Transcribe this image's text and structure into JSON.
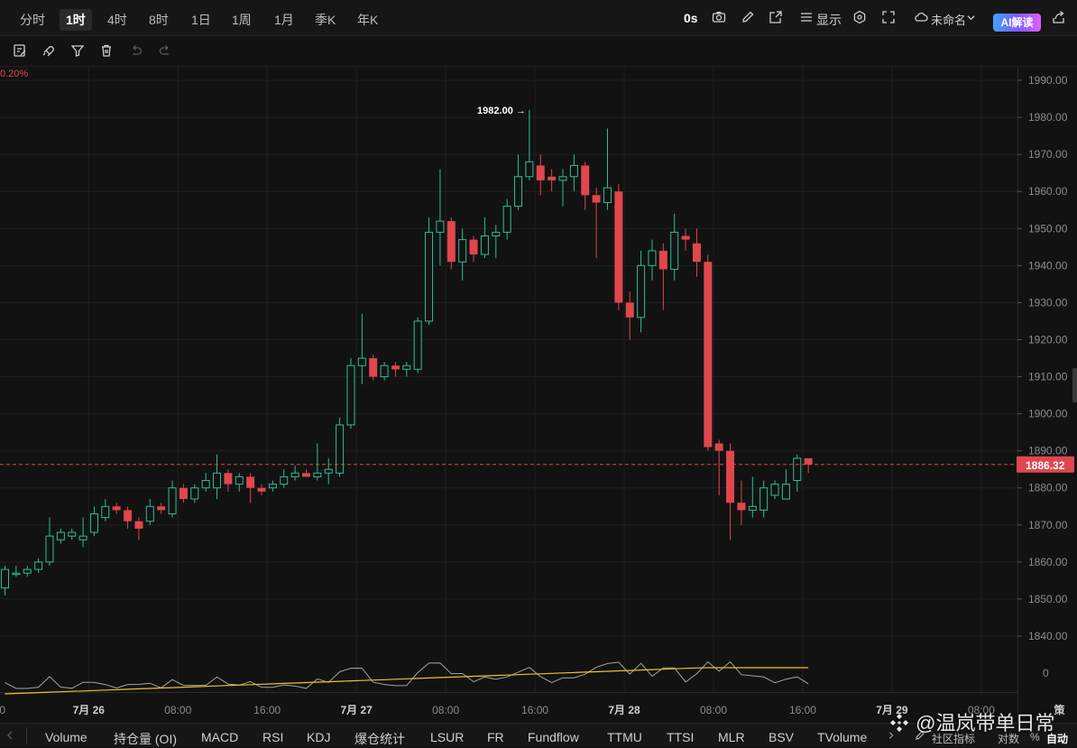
{
  "timeframes": [
    "分时",
    "1时",
    "4时",
    "8时",
    "1日",
    "1周",
    "1月",
    "季K",
    "年K"
  ],
  "active_timeframe": "1时",
  "right_tools": {
    "countdown": "0s",
    "display_label": "显示",
    "layout_name": "未命名",
    "ai_label": "AI解读"
  },
  "percent_label": "0.20%",
  "chart_data": {
    "type": "candlestick",
    "ylim": [
      1835,
      1995
    ],
    "y_ticks": [
      1990,
      1980,
      1970,
      1960,
      1950,
      1940,
      1930,
      1920,
      1910,
      1900,
      1890,
      1880,
      1870,
      1860,
      1850,
      1840
    ],
    "y_tick_labels": [
      "1990.00",
      "1980.00",
      "1970.00",
      "1960.00",
      "1950.00",
      "1940.00",
      "1930.00",
      "1920.00",
      "1910.00",
      "1900.00",
      "1890.00",
      "1880.00",
      "1870.00",
      "1860.00",
      "1850.00",
      "1840.00"
    ],
    "x_labels": [
      {
        "label": "00",
        "bar": -0.5
      },
      {
        "label": "7月 26",
        "bar": 7.5
      },
      {
        "label": "08:00",
        "bar": 15.5
      },
      {
        "label": "16:00",
        "bar": 23.5
      },
      {
        "label": "7月 27",
        "bar": 31.5
      },
      {
        "label": "08:00",
        "bar": 39.5
      },
      {
        "label": "16:00",
        "bar": 47.5
      },
      {
        "label": "7月 28",
        "bar": 55.5
      },
      {
        "label": "08:00",
        "bar": 63.5
      },
      {
        "label": "16:00",
        "bar": 71.5
      },
      {
        "label": "7月 29",
        "bar": 79.5
      },
      {
        "label": "08:00",
        "bar": 87.5
      },
      {
        "label": "策",
        "bar": 94.5
      }
    ],
    "current_price": 1886.32,
    "current_price_label": "1886.32",
    "high_label": "1982.00 →",
    "high_value": 1982.0,
    "candles": [
      [
        1853,
        1858,
        1851,
        1859
      ],
      [
        1857,
        1857,
        1856,
        1859
      ],
      [
        1857,
        1858,
        1856,
        1859
      ],
      [
        1858,
        1860,
        1857,
        1861
      ],
      [
        1860,
        1867,
        1859,
        1872
      ],
      [
        1866,
        1868,
        1865,
        1869
      ],
      [
        1867,
        1868,
        1866,
        1869
      ],
      [
        1866,
        1867,
        1864,
        1872
      ],
      [
        1868,
        1873,
        1867,
        1875
      ],
      [
        1872,
        1875,
        1871,
        1877
      ],
      [
        1875,
        1874,
        1873,
        1876
      ],
      [
        1874,
        1871,
        1869,
        1875
      ],
      [
        1871,
        1869,
        1866,
        1872
      ],
      [
        1871,
        1875,
        1870,
        1877
      ],
      [
        1875,
        1874,
        1873,
        1876
      ],
      [
        1873,
        1880,
        1872,
        1882
      ],
      [
        1880,
        1877,
        1876,
        1881
      ],
      [
        1877,
        1880,
        1876,
        1881
      ],
      [
        1880,
        1882,
        1879,
        1884
      ],
      [
        1880,
        1884,
        1877,
        1889
      ],
      [
        1884,
        1881,
        1879,
        1885
      ],
      [
        1881,
        1883,
        1879,
        1884
      ],
      [
        1883,
        1880,
        1876,
        1884
      ],
      [
        1880,
        1879,
        1878,
        1881
      ],
      [
        1880,
        1881,
        1879,
        1882
      ],
      [
        1881,
        1883,
        1880,
        1885
      ],
      [
        1883,
        1884,
        1882,
        1886
      ],
      [
        1884,
        1883,
        1883,
        1885
      ],
      [
        1883,
        1884,
        1882,
        1892
      ],
      [
        1884,
        1885,
        1881,
        1888
      ],
      [
        1884,
        1897,
        1883,
        1899
      ],
      [
        1897,
        1913,
        1896,
        1915
      ],
      [
        1913,
        1915,
        1908,
        1927
      ],
      [
        1915,
        1910,
        1909,
        1916
      ],
      [
        1910,
        1913,
        1909,
        1914
      ],
      [
        1913,
        1912,
        1910,
        1914
      ],
      [
        1912,
        1913,
        1910,
        1914
      ],
      [
        1912,
        1925,
        1911,
        1926
      ],
      [
        1925,
        1949,
        1924,
        1953
      ],
      [
        1949,
        1952,
        1940,
        1966
      ],
      [
        1952,
        1941,
        1939,
        1953
      ],
      [
        1941,
        1947,
        1936,
        1950
      ],
      [
        1947,
        1943,
        1941,
        1948
      ],
      [
        1943,
        1948,
        1942,
        1953
      ],
      [
        1948,
        1949,
        1942,
        1951
      ],
      [
        1949,
        1956,
        1947,
        1958
      ],
      [
        1956,
        1964,
        1955,
        1970
      ],
      [
        1964,
        1968,
        1963,
        1982
      ],
      [
        1967,
        1963,
        1959,
        1970
      ],
      [
        1964,
        1963,
        1960,
        1966
      ],
      [
        1963,
        1964,
        1956,
        1966
      ],
      [
        1964,
        1967,
        1960,
        1970
      ],
      [
        1967,
        1959,
        1955,
        1968
      ],
      [
        1959,
        1957,
        1942,
        1961
      ],
      [
        1957,
        1961,
        1955,
        1977
      ],
      [
        1960,
        1930,
        1928,
        1962
      ],
      [
        1930,
        1926,
        1920,
        1933
      ],
      [
        1926,
        1940,
        1922,
        1944
      ],
      [
        1940,
        1944,
        1936,
        1947
      ],
      [
        1944,
        1939,
        1928,
        1946
      ],
      [
        1939,
        1949,
        1936,
        1954
      ],
      [
        1948,
        1947,
        1944,
        1950
      ],
      [
        1946,
        1941,
        1937,
        1950
      ],
      [
        1941,
        1891,
        1890,
        1943
      ],
      [
        1892,
        1890,
        1878,
        1893
      ],
      [
        1890,
        1876,
        1866,
        1892
      ],
      [
        1876,
        1874,
        1870,
        1882
      ],
      [
        1874,
        1875,
        1872,
        1883
      ],
      [
        1874,
        1880,
        1872,
        1882
      ],
      [
        1878,
        1881,
        1877,
        1882
      ],
      [
        1877,
        1881,
        1877,
        1885
      ],
      [
        1882,
        1888,
        1879,
        1889
      ],
      [
        1888,
        1886.32,
        1884,
        1888
      ]
    ],
    "volume_label": "0"
  },
  "bottom_indicators": [
    "Volume",
    "持仓量 (OI)",
    "MACD",
    "RSI",
    "KDJ",
    "爆仓统计",
    "LSUR",
    "FR",
    "Fundflow",
    "TTMU",
    "TTSI",
    "MLR",
    "BSV",
    "TVolume"
  ],
  "bottom_right": {
    "community": "社区指标",
    "log": "对数",
    "percent": "%",
    "auto": "自动"
  },
  "watermark": "@温岚带单日常",
  "colors": {
    "up": "#2cbf96",
    "down": "#e0474c",
    "price_line": "#e0474c",
    "vol_yellow": "#e8c51f",
    "vol_white": "#bdbdbd"
  }
}
